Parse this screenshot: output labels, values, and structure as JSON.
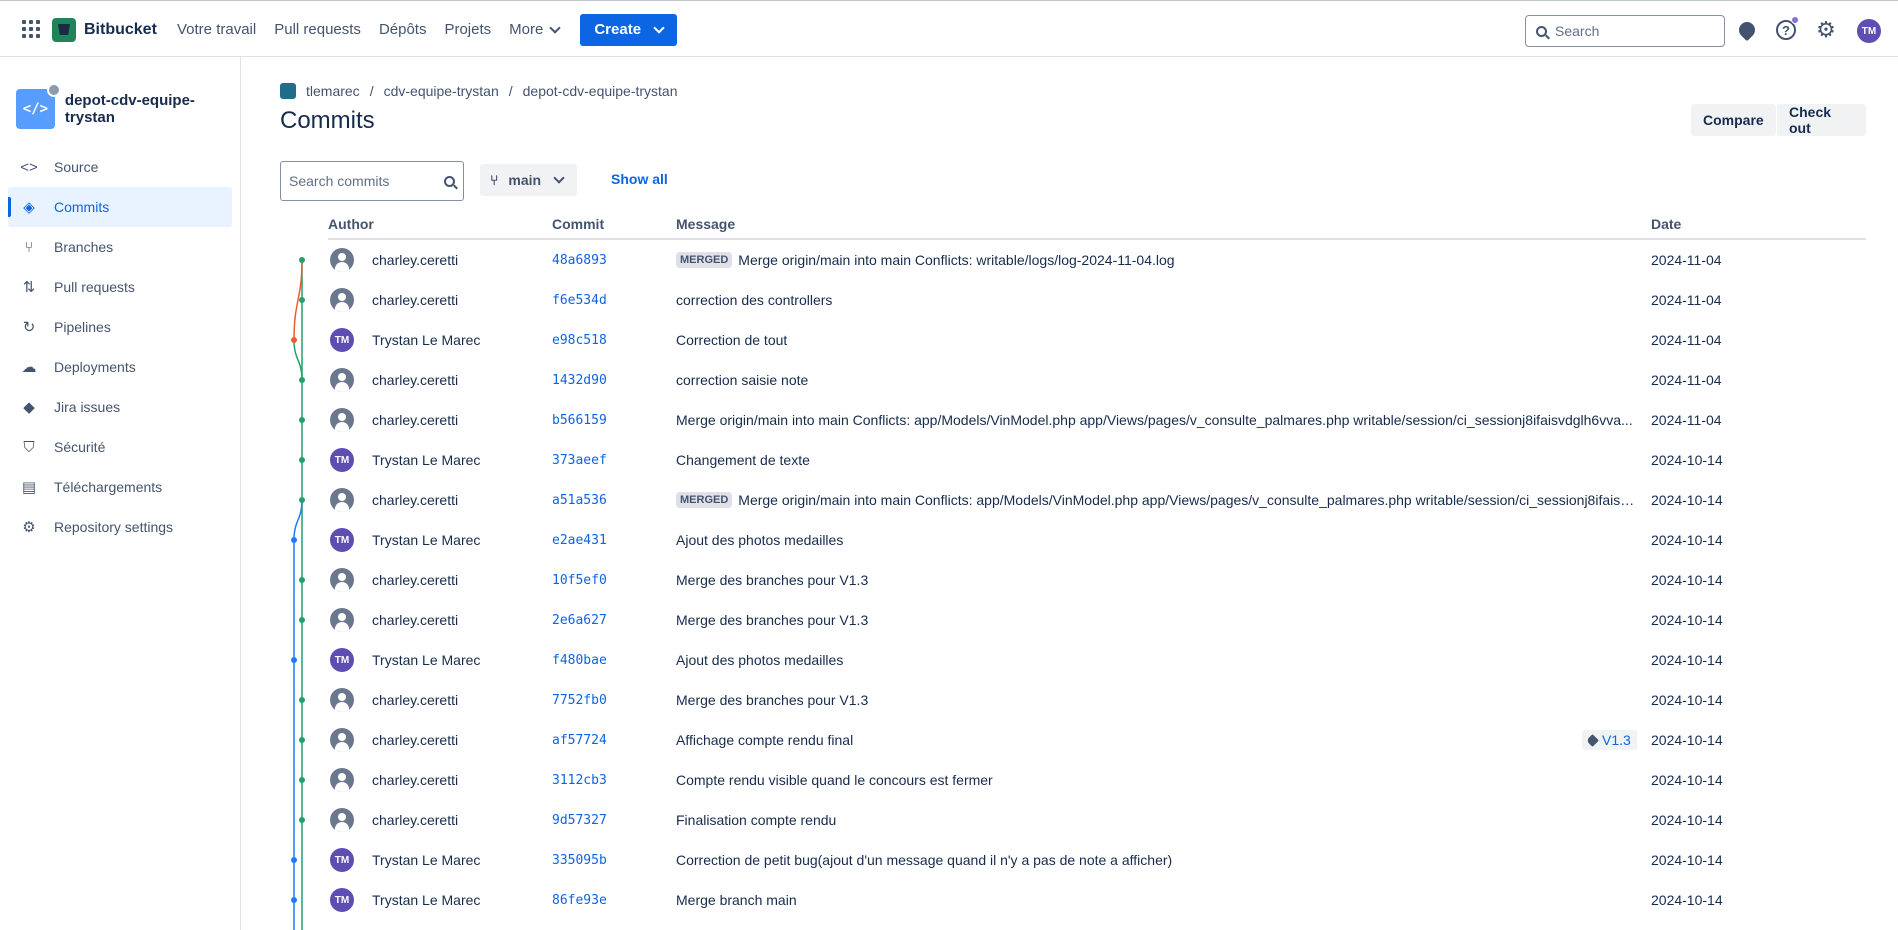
{
  "topbar": {
    "product": "Bitbucket",
    "nav": [
      {
        "label": "Votre travail"
      },
      {
        "label": "Pull requests"
      },
      {
        "label": "Dépôts"
      },
      {
        "label": "Projets"
      },
      {
        "label": "More"
      }
    ],
    "create_label": "Create",
    "search_placeholder": "Search",
    "help_glyph": "?",
    "user_initials": "TM",
    "icons": [
      "app-switcher-icon",
      "bitbucket-logo",
      "notifications-icon",
      "help-icon",
      "settings-icon"
    ]
  },
  "sidebar": {
    "repo_name": "depot-cdv-equipe-trystan",
    "repo_icon_glyph": "</>",
    "items": [
      {
        "label": "Source",
        "icon": "code-icon",
        "glyph": "<>"
      },
      {
        "label": "Commits",
        "icon": "commit-icon",
        "glyph": "◈"
      },
      {
        "label": "Branches",
        "icon": "branch-icon",
        "glyph": "⑂"
      },
      {
        "label": "Pull requests",
        "icon": "pull-request-icon",
        "glyph": "⇅"
      },
      {
        "label": "Pipelines",
        "icon": "pipelines-icon",
        "glyph": "↻"
      },
      {
        "label": "Deployments",
        "icon": "deployments-icon",
        "glyph": "☁"
      },
      {
        "label": "Jira issues",
        "icon": "jira-icon",
        "glyph": "◆"
      },
      {
        "label": "Sécurité",
        "icon": "shield-icon",
        "glyph": "⛉"
      },
      {
        "label": "Téléchargements",
        "icon": "file-icon",
        "glyph": "▤"
      },
      {
        "label": "Repository settings",
        "icon": "gear-icon",
        "glyph": "⚙"
      }
    ],
    "active_index": 1
  },
  "breadcrumb": [
    "tlemarec",
    "cdv-equipe-trystan",
    "depot-cdv-equipe-trystan"
  ],
  "breadcrumb_sep": "/",
  "page": {
    "title": "Commits",
    "compare_label": "Compare",
    "checkout_label": "Check out",
    "search_placeholder": "Search commits",
    "branch": "main",
    "show_all_label": "Show all"
  },
  "table": {
    "headers": {
      "author": "Author",
      "commit": "Commit",
      "message": "Message",
      "date": "Date"
    },
    "merged_label": "MERGED",
    "rows": [
      {
        "author": "charley.ceretti",
        "avatar": "generic",
        "hash": "48a6893",
        "merged": true,
        "message": "Merge origin/main into main Conflicts: writable/logs/log-2024-11-04.log",
        "tag": "",
        "date": "2024-11-04",
        "lane": 1
      },
      {
        "author": "charley.ceretti",
        "avatar": "generic",
        "hash": "f6e534d",
        "merged": false,
        "message": "correction des controllers",
        "tag": "",
        "date": "2024-11-04",
        "lane": 1
      },
      {
        "author": "Trystan Le Marec",
        "avatar": "TM",
        "hash": "e98c518",
        "merged": false,
        "message": "Correction de tout",
        "tag": "",
        "date": "2024-11-04",
        "lane": 0
      },
      {
        "author": "charley.ceretti",
        "avatar": "generic",
        "hash": "1432d90",
        "merged": false,
        "message": "correction saisie note",
        "tag": "",
        "date": "2024-11-04",
        "lane": 1
      },
      {
        "author": "charley.ceretti",
        "avatar": "generic",
        "hash": "b566159",
        "merged": false,
        "message": "Merge origin/main into main Conflicts: app/Models/VinModel.php app/Views/pages/v_consulte_palmares.php writable/session/ci_sessionj8ifaisvdglh6vva...",
        "tag": "",
        "date": "2024-11-04",
        "lane": 1
      },
      {
        "author": "Trystan Le Marec",
        "avatar": "TM",
        "hash": "373aeef",
        "merged": false,
        "message": "Changement de texte",
        "tag": "",
        "date": "2024-10-14",
        "lane": 1
      },
      {
        "author": "charley.ceretti",
        "avatar": "generic",
        "hash": "a51a536",
        "merged": true,
        "message": "Merge origin/main into main Conflicts: app/Models/VinModel.php app/Views/pages/v_consulte_palmares.php writable/session/ci_sessionj8ifaisv...",
        "tag": "",
        "date": "2024-10-14",
        "lane": 1
      },
      {
        "author": "Trystan Le Marec",
        "avatar": "TM",
        "hash": "e2ae431",
        "merged": false,
        "message": "Ajout des photos medailles",
        "tag": "",
        "date": "2024-10-14",
        "lane": 0
      },
      {
        "author": "charley.ceretti",
        "avatar": "generic",
        "hash": "10f5ef0",
        "merged": false,
        "message": "Merge des branches pour V1.3",
        "tag": "",
        "date": "2024-10-14",
        "lane": 1
      },
      {
        "author": "charley.ceretti",
        "avatar": "generic",
        "hash": "2e6a627",
        "merged": false,
        "message": "Merge des branches pour V1.3",
        "tag": "",
        "date": "2024-10-14",
        "lane": 1
      },
      {
        "author": "Trystan Le Marec",
        "avatar": "TM",
        "hash": "f480bae",
        "merged": false,
        "message": "Ajout des photos medailles",
        "tag": "",
        "date": "2024-10-14",
        "lane": 0
      },
      {
        "author": "charley.ceretti",
        "avatar": "generic",
        "hash": "7752fb0",
        "merged": false,
        "message": "Merge des branches pour V1.3",
        "tag": "",
        "date": "2024-10-14",
        "lane": 1
      },
      {
        "author": "charley.ceretti",
        "avatar": "generic",
        "hash": "af57724",
        "merged": false,
        "message": "Affichage compte rendu final",
        "tag": "V1.3",
        "date": "2024-10-14",
        "lane": 1
      },
      {
        "author": "charley.ceretti",
        "avatar": "generic",
        "hash": "3112cb3",
        "merged": false,
        "message": "Compte rendu visible quand le concours est fermer",
        "tag": "",
        "date": "2024-10-14",
        "lane": 1
      },
      {
        "author": "charley.ceretti",
        "avatar": "generic",
        "hash": "9d57327",
        "merged": false,
        "message": "Finalisation compte rendu",
        "tag": "",
        "date": "2024-10-14",
        "lane": 1
      },
      {
        "author": "Trystan Le Marec",
        "avatar": "TM",
        "hash": "335095b",
        "merged": false,
        "message": "Correction de petit bug(ajout d'un message quand il n'y a pas de note a afficher)",
        "tag": "",
        "date": "2024-10-14",
        "lane": 0
      },
      {
        "author": "Trystan Le Marec",
        "avatar": "TM",
        "hash": "86fe93e",
        "merged": false,
        "message": "Merge branch main",
        "tag": "",
        "date": "2024-10-14",
        "lane": 0
      }
    ]
  },
  "colors": {
    "accent": "#0c66e4",
    "graph_green": "#22a06b",
    "graph_orange": "#f15b2a",
    "graph_blue": "#1d7afc",
    "avatar_purple": "#5e4db2"
  }
}
